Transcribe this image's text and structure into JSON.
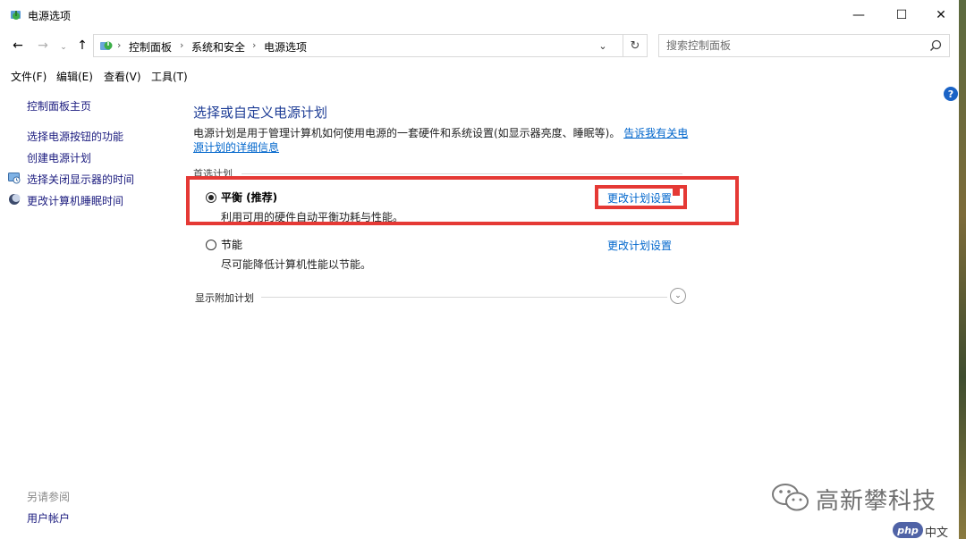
{
  "window": {
    "title": "电源选项",
    "controls": {
      "minimize": "—",
      "maximize": "☐",
      "close": "✕"
    }
  },
  "address": {
    "breadcrumbs": [
      "控制面板",
      "系统和安全",
      "电源选项"
    ],
    "search_placeholder": "搜索控制面板"
  },
  "menu": [
    "文件(F)",
    "编辑(E)",
    "查看(V)",
    "工具(T)"
  ],
  "sidebar": {
    "home": "控制面板主页",
    "links": [
      "选择电源按钮的功能",
      "创建电源计划",
      "选择关闭显示器的时间",
      "更改计算机睡眠时间"
    ],
    "see_also": "另请参阅",
    "user_accounts": "用户帐户"
  },
  "main": {
    "heading": "选择或自定义电源计划",
    "description": "电源计划是用于管理计算机如何使用电源的一套硬件和系统设置(如显示器亮度、睡眠等)。",
    "description_link": "告诉我有关电源计划的详细信息",
    "preferred_label": "首选计划",
    "plans": [
      {
        "name": "平衡 (推荐)",
        "desc": "利用可用的硬件自动平衡功耗与性能。",
        "link": "更改计划设置",
        "selected": true
      },
      {
        "name": "节能",
        "desc": "尽可能降低计算机性能以节能。",
        "link": "更改计划设置",
        "selected": false
      }
    ],
    "additional_label": "显示附加计划"
  },
  "help_icon": "?",
  "watermark": {
    "brand": "高新攀科技",
    "php": "php",
    "cn": "中文网"
  },
  "colors": {
    "highlight": "#e53935",
    "link": "#0066cc",
    "heading": "#1e3d96"
  }
}
